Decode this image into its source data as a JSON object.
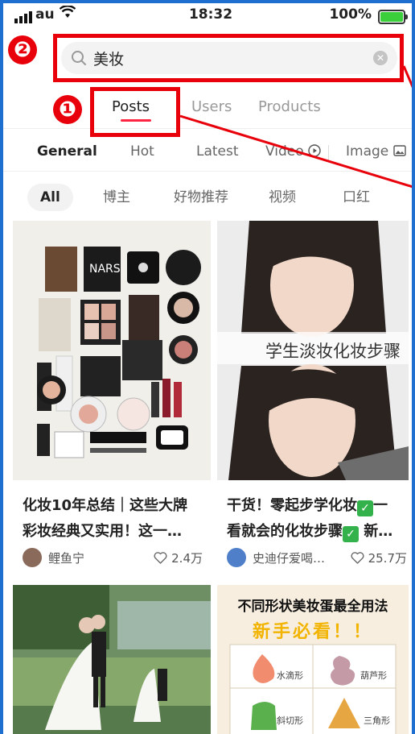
{
  "status": {
    "carrier": "au",
    "time": "18:32",
    "battery": "100%"
  },
  "search": {
    "query": "美妆",
    "clear_icon": "clear-icon"
  },
  "annotations": {
    "badge1": "❶",
    "badge2": "❷"
  },
  "tabs": [
    {
      "label": "Posts",
      "active": true
    },
    {
      "label": "Users",
      "active": false
    },
    {
      "label": "Products",
      "active": false
    }
  ],
  "sort": [
    {
      "label": "General",
      "active": true
    },
    {
      "label": "Hot"
    },
    {
      "label": "Latest"
    },
    {
      "label": "Video"
    },
    {
      "label": "Image"
    }
  ],
  "chips": [
    {
      "label": "All",
      "active": true
    },
    {
      "label": "博主"
    },
    {
      "label": "好物推荐"
    },
    {
      "label": "视频"
    },
    {
      "label": "口红"
    }
  ],
  "feed": [
    {
      "title_line1": "化妆10年总结｜这些大牌",
      "title_line2": "彩妆经典又实用！这一…",
      "author": "鲤鱼宁",
      "likes": "2.4万"
    },
    {
      "title_a": "干货！零起步学化妆",
      "title_b": "一",
      "title_c": "看就会的化妆步骤",
      "title_d": "新…",
      "image_caption": "学生淡妆化妆步骤",
      "author": "史迪仔爱喝…",
      "likes": "25.7万"
    },
    {
      "image_caption": ""
    },
    {
      "image_title": "不同形状美妆蛋最全用法",
      "image_subtitle": "新手必看！！",
      "quadrants": [
        "水滴形",
        "葫芦形",
        "斜切形",
        "三角形"
      ]
    }
  ],
  "colors": {
    "accent": "#ff2442",
    "annotation": "#e8000b",
    "check": "#33b14a"
  }
}
